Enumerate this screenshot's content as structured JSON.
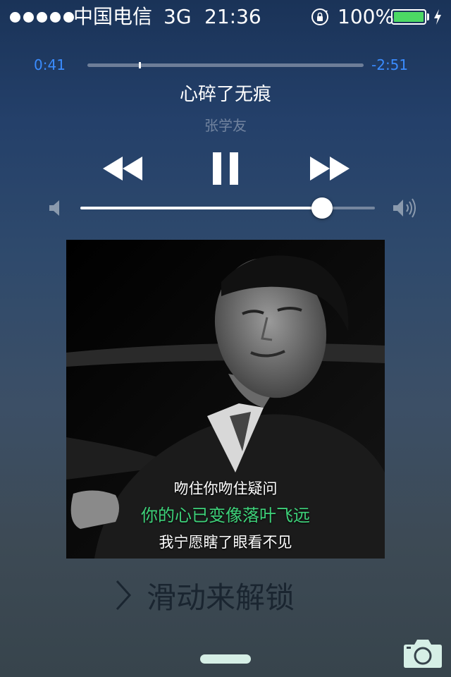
{
  "status_bar": {
    "carrier": "中国电信",
    "network": "3G",
    "time": "21:36",
    "battery_percent": "100%",
    "battery_level": 1.0,
    "signal_dots": 5,
    "icons": [
      "signal-dots-icon",
      "rotation-lock-icon",
      "battery-icon",
      "charging-bolt-icon"
    ]
  },
  "player": {
    "elapsed": "0:41",
    "remaining": "-2:51",
    "progress": 0.19,
    "song_title": "心碎了无痕",
    "artist": "张学友",
    "controls": {
      "rewind_icon": "rewind-icon",
      "pause_icon": "pause-icon",
      "forward_icon": "fast-forward-icon"
    },
    "volume": 0.82,
    "volume_icons": [
      "volume-low-icon",
      "volume-high-icon"
    ]
  },
  "album_art": {
    "lyrics": [
      "吻住你吻住疑问",
      "你的心已变像落叶飞远",
      "我宁愿瞎了眼看不见"
    ],
    "highlight_color": "#3ed27a"
  },
  "lock_screen": {
    "unlock_text": "滑动来解锁",
    "camera_icon": "camera-icon"
  },
  "colors": {
    "accent_blue": "#3a8cff",
    "battery_green": "#4cd964"
  }
}
